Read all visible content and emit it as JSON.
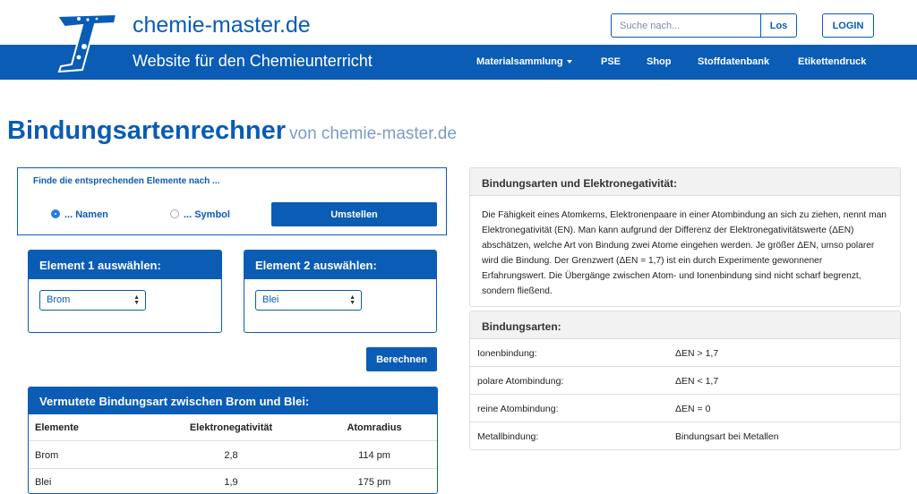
{
  "brand": {
    "name": "chemie-master.de",
    "tagline": "Website für den Chemieunterricht"
  },
  "search": {
    "placeholder": "Suche nach...",
    "button": "Los"
  },
  "login_label": "LOGIN",
  "nav": [
    "Materialsammlung",
    "PSE",
    "Shop",
    "Stoffdatenbank",
    "Etikettendruck"
  ],
  "page": {
    "title": "Bindungsartenrechner",
    "subtitle": "von chemie-master.de"
  },
  "finder": {
    "title": "Finde die entsprechenden Elemente nach ...",
    "option_names": "... Namen",
    "option_symbol": "... Symbol",
    "selected": "names",
    "switch_button": "Umstellen"
  },
  "element1": {
    "heading": "Element 1 auswählen:",
    "value": "Brom"
  },
  "element2": {
    "heading": "Element 2 auswählen:",
    "value": "Blei"
  },
  "calculate_button": "Berechnen",
  "result": {
    "heading": "Vermutete Bindungsart zwischen Brom und Blei:",
    "columns": [
      "Elemente",
      "Elektronegativität",
      "Atomradius"
    ],
    "rows": [
      [
        "Brom",
        "2,8",
        "114 pm"
      ],
      [
        "Blei",
        "1,9",
        "175 pm"
      ]
    ]
  },
  "info": {
    "heading": "Bindungsarten und Elektronegativität:",
    "body": "Die Fähigkeit eines Atomkerns, Elektronenpaare in einer Atombindung an sich zu ziehen, nennt man Elektronegativität (EN). Man kann aufgrund der Differenz der Elektronegativitätswerte (ΔEN) abschätzen, welche Art von Bindung zwei Atome eingehen werden. Je größer ΔEN, umso polarer wird die Bindung. Der Grenzwert (ΔEN = 1,7) ist ein durch Experimente gewonnener Erfahrungswert. Die Übergänge zwischen Atom- und Ionenbindung sind nicht scharf begrenzt, sondern fließend."
  },
  "types": {
    "heading": "Bindungsarten:",
    "rows": [
      [
        "Ionenbindung:",
        "ΔEN > 1,7"
      ],
      [
        "polare Atombindung:",
        "ΔEN < 1,7"
      ],
      [
        "reine Atombindung:",
        "ΔEN = 0"
      ],
      [
        "Metallbindung:",
        "Bindungsart bei Metallen"
      ]
    ]
  },
  "colors": {
    "brand_blue": "#0a5cb5",
    "subtitle_blue": "#7a9cc6",
    "panel_gray": "#f2f2f2"
  }
}
